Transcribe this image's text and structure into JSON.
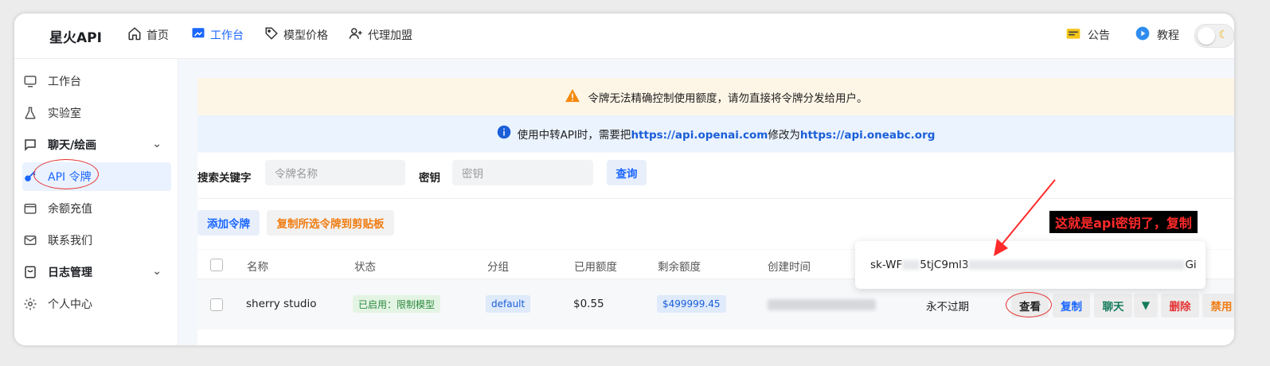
{
  "topbar": {
    "brand": "星火API",
    "nav": [
      {
        "label": "首页",
        "icon": "home-icon"
      },
      {
        "label": "工作台",
        "icon": "dashboard-icon",
        "active": true
      },
      {
        "label": "模型价格",
        "icon": "tag-icon"
      },
      {
        "label": "代理加盟",
        "icon": "user-plus-icon"
      }
    ],
    "announcement": "公告",
    "tutorial": "教程"
  },
  "sidebar": {
    "items": [
      {
        "label": "工作台",
        "icon": "monitor-icon"
      },
      {
        "label": "实验室",
        "icon": "flask-icon"
      },
      {
        "label": "聊天/绘画",
        "icon": "chat-icon",
        "group": true
      },
      {
        "label": "API 令牌",
        "icon": "key-icon",
        "active": true
      },
      {
        "label": "余额充值",
        "icon": "wallet-icon"
      },
      {
        "label": "联系我们",
        "icon": "mail-icon"
      },
      {
        "label": "日志管理",
        "icon": "log-icon",
        "group": true
      },
      {
        "label": "个人中心",
        "icon": "gear-icon"
      }
    ]
  },
  "banners": {
    "warning": "令牌无法精确控制使用额度，请勿直接将令牌分发给用户。",
    "info_prefix": "使用中转API时，需要把",
    "info_link1": "https://api.openai.com",
    "info_middle": "修改为",
    "info_link2": "https://api.oneabc.org"
  },
  "filters": {
    "keyword_label": "搜索关键字",
    "keyword_placeholder": "令牌名称",
    "key_label": "密钥",
    "key_placeholder": "密钥",
    "search_button": "查询"
  },
  "actions": {
    "add_token": "添加令牌",
    "copy_selected": "复制所选令牌到剪贴板"
  },
  "table": {
    "headers": [
      "名称",
      "状态",
      "分组",
      "已用额度",
      "剩余额度",
      "创建时间"
    ],
    "rows": [
      {
        "name": "sherry studio",
        "status": "已启用：限制模型",
        "group": "default",
        "used": "$0.55",
        "remaining": "$499999.45",
        "expiry": "永不过期",
        "actions": [
          "查看",
          "复制",
          "聊天",
          "删除",
          "禁用"
        ]
      }
    ]
  },
  "popover": {
    "key_prefix": "sk-WF",
    "key_middle": "5tjC9ml3",
    "key_suffix": "Gi"
  },
  "annotation": {
    "text": "这就是api密钥了，复制"
  },
  "colors": {
    "primary": "#1a66ff",
    "orange": "#f07c12",
    "danger": "#e53030",
    "annotation_red": "#ff2a2a"
  }
}
